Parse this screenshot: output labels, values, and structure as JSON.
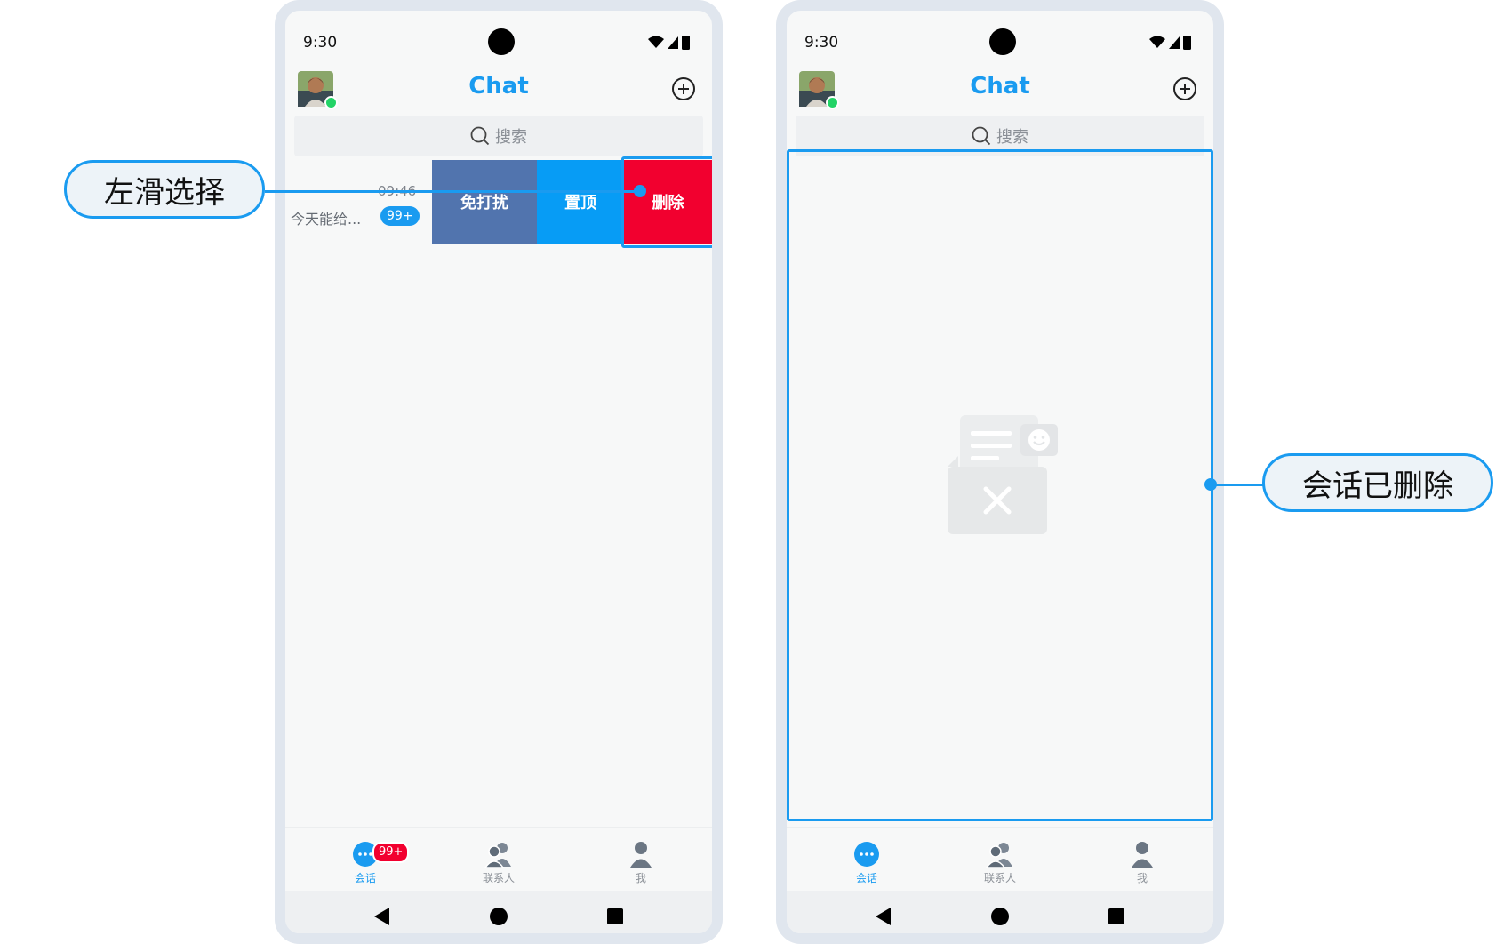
{
  "colors": {
    "accent": "#1a9bf0",
    "mute_button": "#5174ae",
    "pin_button": "#079cf5",
    "delete_button": "#f2002f",
    "badge_red": "#f2002f",
    "online_green": "#22d366"
  },
  "callouts": {
    "left": "左滑选择",
    "right": "会话已删除"
  },
  "phone_left": {
    "status": {
      "time": "9:30"
    },
    "header": {
      "title": "Chat"
    },
    "search": {
      "placeholder": "搜索"
    },
    "conversation": {
      "time": "09:46",
      "preview": "今天能给...",
      "unread_badge": "99+"
    },
    "swipe_actions": {
      "mute": "免打扰",
      "pin": "置顶",
      "delete": "删除"
    },
    "tabs": [
      {
        "label": "会话",
        "badge": "99+",
        "active": true
      },
      {
        "label": "联系人",
        "active": false
      },
      {
        "label": "我",
        "active": false
      }
    ]
  },
  "phone_right": {
    "status": {
      "time": "9:30"
    },
    "header": {
      "title": "Chat"
    },
    "search": {
      "placeholder": "搜索"
    },
    "tabs": [
      {
        "label": "会话",
        "active": true
      },
      {
        "label": "联系人",
        "active": false
      },
      {
        "label": "我",
        "active": false
      }
    ]
  }
}
